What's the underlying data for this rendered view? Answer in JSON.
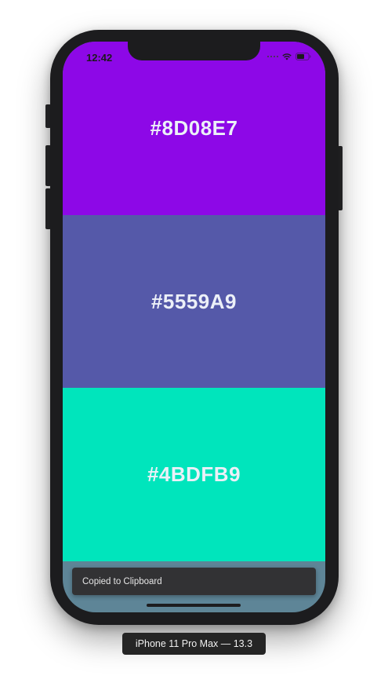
{
  "status_bar": {
    "time": "12:42"
  },
  "swatches": [
    {
      "label": "#8D08E7",
      "color": "#8D08E7"
    },
    {
      "label": "#5559A9",
      "color": "#5559A9"
    },
    {
      "label": "#4BDFB9",
      "color": "#00E5BC"
    }
  ],
  "toast": {
    "message": "Copied to Clipboard"
  },
  "device_label": "iPhone 11 Pro Max — 13.3",
  "colors": {
    "screen_background": "#5e8597",
    "frame": "#1c1c1e",
    "toast_background": "#323234"
  },
  "icons": [
    "signal-dots-icon",
    "wifi-icon",
    "battery-icon"
  ]
}
